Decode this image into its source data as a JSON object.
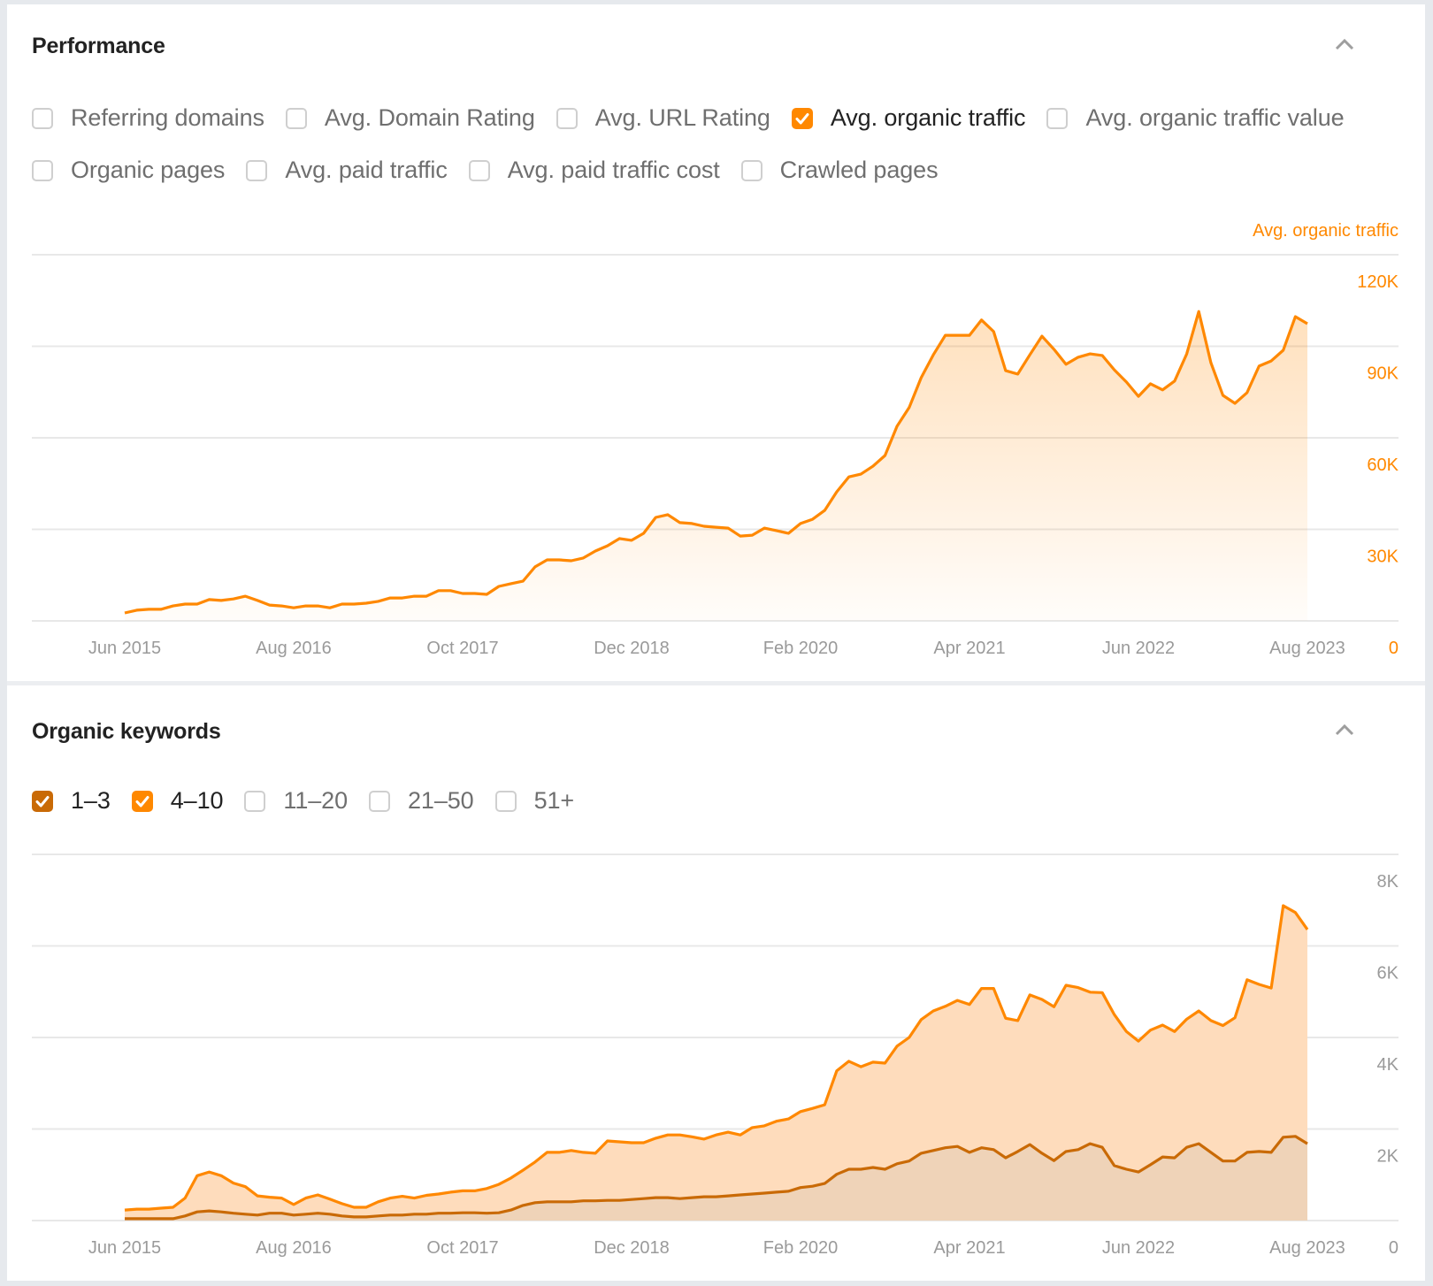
{
  "performance": {
    "title": "Performance",
    "collapse_icon": "chevron-up-icon",
    "checkbox_rows": [
      [
        {
          "label": "Referring domains",
          "checked": false
        },
        {
          "label": "Avg. Domain Rating",
          "checked": false
        },
        {
          "label": "Avg. URL Rating",
          "checked": false
        },
        {
          "label": "Avg. organic traffic",
          "checked": true,
          "color": "#ff8800"
        },
        {
          "label": "Avg. organic traffic value",
          "checked": false
        }
      ],
      [
        {
          "label": "Organic pages",
          "checked": false
        },
        {
          "label": "Avg. paid traffic",
          "checked": false
        },
        {
          "label": "Avg. paid traffic cost",
          "checked": false
        },
        {
          "label": "Crawled pages",
          "checked": false
        }
      ]
    ]
  },
  "organic_keywords": {
    "title": "Organic keywords",
    "collapse_icon": "chevron-up-icon",
    "checkboxes": [
      {
        "label": "1–3",
        "checked": true,
        "color": "#c96a06"
      },
      {
        "label": "4–10",
        "checked": true,
        "color": "#ff8800"
      },
      {
        "label": "11–20",
        "checked": false
      },
      {
        "label": "21–50",
        "checked": false
      },
      {
        "label": "51+",
        "checked": false
      }
    ]
  },
  "colors": {
    "accent": "#ff8800",
    "dark_accent": "#c96a06",
    "axis_text": "#9a9a9a",
    "grid": "#e8e8e8"
  },
  "chart_data": [
    {
      "type": "area",
      "title": "Performance",
      "series_label": "Avg. organic traffic",
      "xlabel": "",
      "ylabel": "Avg. organic traffic",
      "x_start": "Jun 2015",
      "x_end": "Aug 2023",
      "x_interval": "monthly",
      "x_tick_labels": [
        "Jun 2015",
        "Aug 2016",
        "Oct 2017",
        "Dec 2018",
        "Feb 2020",
        "Apr 2021",
        "Jun 2022",
        "Aug 2023"
      ],
      "x_tick_every_months": 14,
      "y_tick_labels": [
        "0",
        "30K",
        "60K",
        "90K",
        "120K"
      ],
      "y_ticks": [
        0,
        30000,
        60000,
        90000,
        120000
      ],
      "ylim": [
        0,
        120000
      ],
      "y_axis_side": "right",
      "grid": true,
      "series": [
        {
          "name": "Avg. organic traffic",
          "color": "#ff8800",
          "values": [
            2600,
            3500,
            3800,
            3800,
            4900,
            5500,
            5500,
            7000,
            6700,
            7200,
            8100,
            6700,
            5200,
            4900,
            4300,
            4900,
            4900,
            4300,
            5500,
            5500,
            5800,
            6400,
            7500,
            7500,
            8100,
            8100,
            9900,
            9900,
            9000,
            9000,
            8700,
            11300,
            12200,
            13000,
            17700,
            20000,
            20000,
            19700,
            20600,
            22900,
            24600,
            27000,
            26400,
            28700,
            33900,
            34800,
            32200,
            31900,
            31000,
            30700,
            30400,
            27800,
            28100,
            30400,
            29600,
            28700,
            31900,
            33300,
            36200,
            42300,
            47200,
            48100,
            50700,
            54200,
            63800,
            69900,
            79700,
            87200,
            93600,
            93600,
            93600,
            98600,
            94800,
            82000,
            80900,
            87200,
            93300,
            89000,
            84100,
            86400,
            87500,
            87000,
            82300,
            78300,
            73600,
            77700,
            75700,
            78600,
            87500,
            101400,
            84600,
            73900,
            71300,
            74800,
            83500,
            85200,
            88700,
            99700,
            97400
          ]
        }
      ]
    },
    {
      "type": "area",
      "stacked": true,
      "title": "Organic keywords",
      "xlabel": "",
      "ylabel": "",
      "x_start": "Jun 2015",
      "x_end": "Aug 2023",
      "x_interval": "monthly",
      "x_tick_labels": [
        "Jun 2015",
        "Aug 2016",
        "Oct 2017",
        "Dec 2018",
        "Feb 2020",
        "Apr 2021",
        "Jun 2022",
        "Aug 2023"
      ],
      "x_tick_every_months": 14,
      "y_tick_labels": [
        "0",
        "2K",
        "4K",
        "6K",
        "8K"
      ],
      "y_ticks": [
        0,
        2000,
        4000,
        6000,
        8000
      ],
      "ylim": [
        0,
        8000
      ],
      "y_axis_side": "right",
      "grid": true,
      "series": [
        {
          "name": "1–3",
          "color": "#c96a06",
          "fill": "#efd3b8",
          "values": [
            40,
            40,
            40,
            40,
            40,
            100,
            190,
            210,
            190,
            160,
            140,
            120,
            160,
            160,
            120,
            140,
            160,
            140,
            100,
            80,
            80,
            100,
            120,
            120,
            140,
            140,
            160,
            160,
            170,
            170,
            160,
            170,
            230,
            330,
            390,
            410,
            410,
            410,
            430,
            430,
            440,
            440,
            460,
            480,
            500,
            500,
            480,
            500,
            520,
            520,
            540,
            560,
            580,
            600,
            620,
            640,
            720,
            750,
            810,
            1010,
            1120,
            1120,
            1160,
            1120,
            1240,
            1300,
            1470,
            1530,
            1590,
            1620,
            1490,
            1590,
            1550,
            1370,
            1510,
            1660,
            1470,
            1310,
            1510,
            1550,
            1680,
            1600,
            1200,
            1120,
            1060,
            1220,
            1390,
            1370,
            1600,
            1680,
            1490,
            1300,
            1300,
            1490,
            1510,
            1490,
            1820,
            1840,
            1680
          ]
        },
        {
          "name": "4–10",
          "color": "#ff8800",
          "fill": "#fedcbc",
          "values": [
            190,
            210,
            210,
            230,
            250,
            390,
            790,
            850,
            790,
            660,
            600,
            420,
            350,
            330,
            230,
            350,
            400,
            330,
            270,
            210,
            210,
            310,
            370,
            410,
            350,
            410,
            420,
            460,
            480,
            480,
            540,
            620,
            700,
            770,
            890,
            1080,
            1080,
            1120,
            1060,
            1040,
            1300,
            1280,
            1240,
            1220,
            1300,
            1370,
            1390,
            1330,
            1260,
            1350,
            1390,
            1310,
            1450,
            1470,
            1550,
            1580,
            1660,
            1700,
            1720,
            2260,
            2360,
            2240,
            2300,
            2320,
            2570,
            2700,
            2920,
            3050,
            3090,
            3190,
            3230,
            3480,
            3520,
            3050,
            2860,
            3270,
            3360,
            3360,
            3630,
            3540,
            3310,
            3380,
            3300,
            3010,
            2860,
            2940,
            2880,
            2760,
            2800,
            2900,
            2880,
            2960,
            3130,
            3770,
            3650,
            3590,
            5060,
            4890,
            4680
          ]
        }
      ]
    }
  ]
}
